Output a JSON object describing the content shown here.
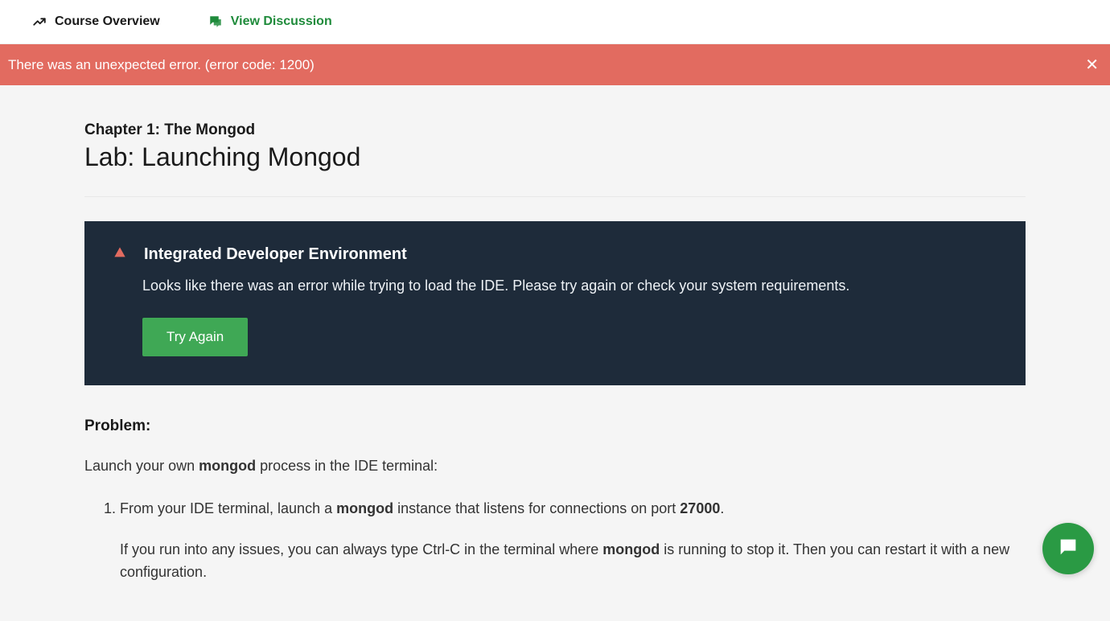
{
  "nav": {
    "overview_label": "Course Overview",
    "discussion_label": "View Discussion"
  },
  "error_banner": {
    "message": "There was an unexpected error. (error code: 1200)"
  },
  "header": {
    "chapter": "Chapter 1: The Mongod",
    "title": "Lab: Launching Mongod"
  },
  "ide_panel": {
    "title": "Integrated Developer Environment",
    "message": "Looks like there was an error while trying to load the IDE. Please try again or check your system requirements.",
    "button_label": "Try Again"
  },
  "problem": {
    "heading": "Problem:",
    "intro_parts": {
      "p1": "Launch your own ",
      "b1": "mongod",
      "p2": " process in the IDE terminal:"
    },
    "step1_parts": {
      "p1": "From your IDE terminal, launch a ",
      "b1": "mongod",
      "p2": " instance that listens for connections on port ",
      "b2": "27000",
      "p3": "."
    },
    "step1_note_parts": {
      "p1": "If you run into any issues, you can always type Ctrl-C in the terminal where ",
      "b1": "mongod",
      "p2": " is running to stop it. Then you can restart it with a new configuration."
    }
  }
}
